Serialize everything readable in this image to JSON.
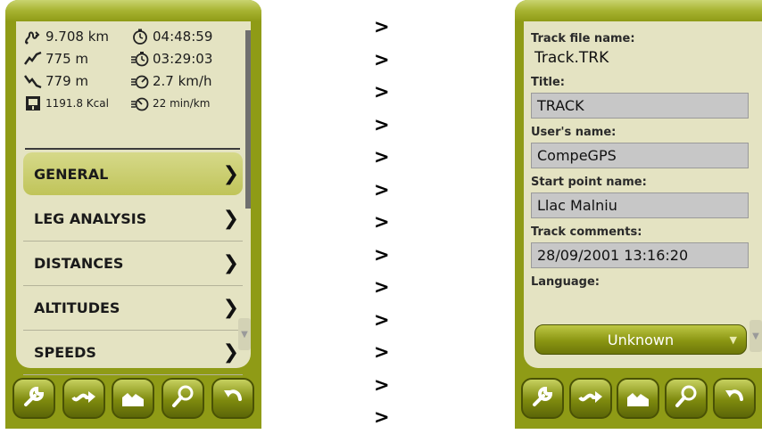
{
  "left": {
    "stats": [
      {
        "icon": "distance-icon",
        "value": "9.708 km",
        "small": false,
        "icon2": "stopwatch-icon",
        "value2": "04:48:59",
        "small2": false
      },
      {
        "icon": "ascent-icon",
        "value": "775 m",
        "small": false,
        "icon2": "moving-time-icon",
        "value2": "03:29:03",
        "small2": false
      },
      {
        "icon": "descent-icon",
        "value": "779 m",
        "small": false,
        "icon2": "speed-icon",
        "value2": "2.7 km/h",
        "small2": false
      },
      {
        "icon": "calories-icon",
        "value": "1191.8 Kcal",
        "small": true,
        "icon2": "pace-icon",
        "value2": "22 min/km",
        "small2": true
      }
    ],
    "menu": [
      {
        "label": "GENERAL",
        "active": true
      },
      {
        "label": "LEG ANALYSIS",
        "active": false
      },
      {
        "label": "DISTANCES",
        "active": false
      },
      {
        "label": "ALTITUDES",
        "active": false
      },
      {
        "label": "SPEEDS",
        "active": false
      }
    ],
    "menu_arrow": "❯",
    "scroll_down": "▼"
  },
  "arrow_glyph": ">",
  "right": {
    "track_file_label": "Track file name:",
    "track_file_value": "Track.TRK",
    "title_label": "Title:",
    "title_value": "TRACK",
    "user_label": "User's name:",
    "user_value": "CompeGPS",
    "start_label": "Start point name:",
    "start_value": "Llac Malniu",
    "comments_label": "Track comments:",
    "comments_value": "28/09/2001 13:16:20",
    "language_label": "Language:",
    "language_value": "Unknown",
    "language_chevron": "▼",
    "scroll_down": "▼"
  },
  "toolbar": [
    "wrench-icon",
    "route-icon",
    "profile-icon",
    "search-icon",
    "back-icon"
  ],
  "colors": {
    "device": "#8f9b16",
    "screen": "#e4e3c2",
    "active_item": "#c9cc6e",
    "field_bg": "#c7c7c7"
  }
}
